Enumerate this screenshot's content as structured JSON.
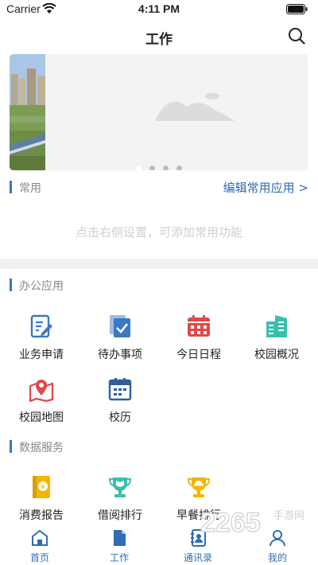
{
  "status_bar": {
    "carrier": "Carrier",
    "time": "4:11 PM"
  },
  "nav": {
    "title": "工作",
    "search_icon": "search-icon"
  },
  "banner": {
    "page_count": 4,
    "active_index": 0
  },
  "common": {
    "title": "常用",
    "edit_link": "编辑常用应用 >",
    "empty_hint": "点击右侧设置，可添加常用功能"
  },
  "office": {
    "title": "办公应用",
    "items": [
      {
        "label": "业务申请",
        "icon": "document-edit-icon",
        "color": "#3a78c4"
      },
      {
        "label": "待办事项",
        "icon": "todo-check-icon",
        "color": "#3a78c4"
      },
      {
        "label": "今日日程",
        "icon": "calendar-icon",
        "color": "#e0484b"
      },
      {
        "label": "校园概况",
        "icon": "building-icon",
        "color": "#3bbfad"
      },
      {
        "label": "校园地图",
        "icon": "map-pin-icon",
        "color": "#e0484b"
      },
      {
        "label": "校历",
        "icon": "school-calendar-icon",
        "color": "#2f5f9e"
      }
    ]
  },
  "data_services": {
    "title": "数据服务",
    "items": [
      {
        "label": "消费报告",
        "icon": "consumption-report-icon",
        "color": "#f2b705"
      },
      {
        "label": "借阅排行",
        "icon": "book-trophy-icon",
        "color": "#3bbfad"
      },
      {
        "label": "早餐排行",
        "icon": "breakfast-trophy-icon",
        "color": "#f2b705"
      }
    ]
  },
  "tab_bar": {
    "items": [
      {
        "label": "首页",
        "icon": "home-icon"
      },
      {
        "label": "工作",
        "icon": "work-file-icon"
      },
      {
        "label": "通讯录",
        "icon": "contacts-icon"
      },
      {
        "label": "我的",
        "icon": "profile-icon"
      }
    ]
  },
  "watermark": {
    "text": "2265手游网"
  },
  "colors": {
    "accent": "#2f6db5",
    "section_bar": "#3a78c4",
    "divider": "#f1f1f1"
  }
}
